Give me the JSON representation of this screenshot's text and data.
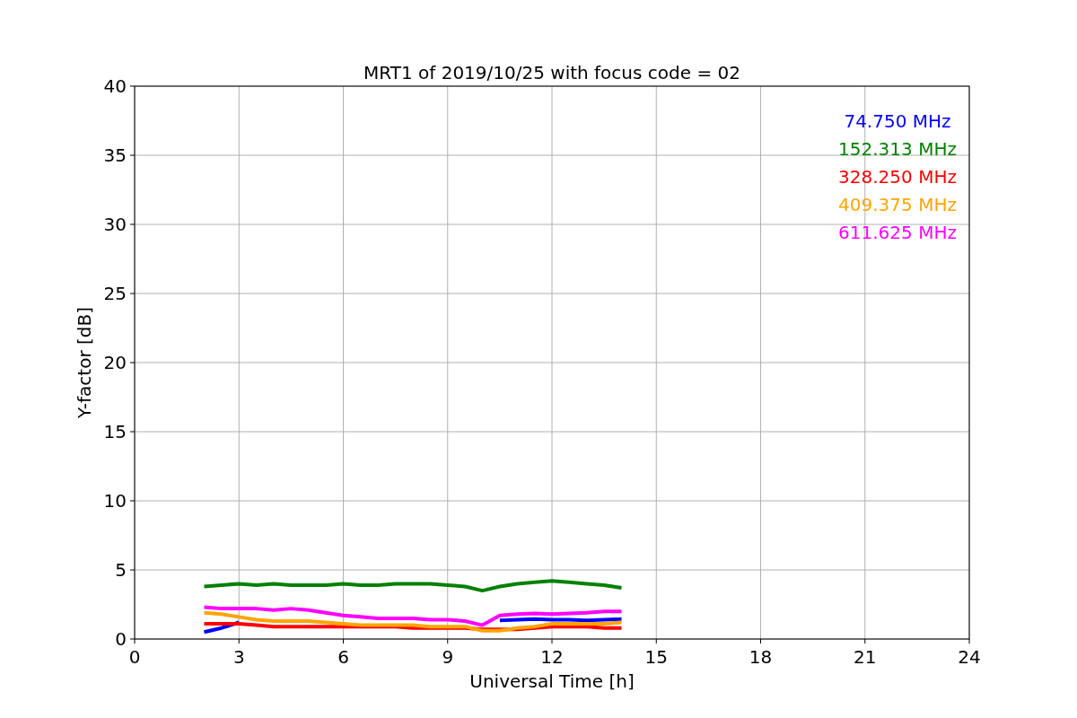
{
  "chart_data": {
    "type": "line",
    "title": "MRT1 of 2019/10/25 with focus code = 02",
    "xlabel": "Universal Time [h]",
    "ylabel": "Y-factor [dB]",
    "x": [
      2,
      2.5,
      3,
      3.5,
      4,
      4.5,
      5,
      5.5,
      6,
      6.5,
      7,
      7.5,
      8,
      8.5,
      9,
      9.5,
      10,
      10.5,
      11,
      11.5,
      12,
      12.5,
      13,
      13.5,
      14
    ],
    "series": [
      {
        "name": "74.750 MHz",
        "color": "#0000ff",
        "values": [
          0.5,
          0.8,
          1.2,
          null,
          null,
          null,
          null,
          null,
          null,
          null,
          null,
          null,
          null,
          null,
          null,
          null,
          null,
          1.35,
          1.4,
          1.45,
          1.4,
          1.4,
          1.35,
          1.4,
          1.45
        ]
      },
      {
        "name": "152.313 MHz",
        "color": "#008000",
        "values": [
          3.8,
          3.9,
          4.0,
          3.9,
          4.0,
          3.9,
          3.9,
          3.9,
          4.0,
          3.9,
          3.9,
          4.0,
          4.0,
          4.0,
          3.9,
          3.8,
          3.5,
          3.8,
          4.0,
          4.1,
          4.2,
          4.1,
          4.0,
          3.9,
          3.7
        ]
      },
      {
        "name": "328.250 MHz",
        "color": "#ff0000",
        "values": [
          1.1,
          1.1,
          1.1,
          1.0,
          0.9,
          0.9,
          0.9,
          0.9,
          0.9,
          0.9,
          0.9,
          0.9,
          0.8,
          0.8,
          0.8,
          0.8,
          0.7,
          0.7,
          0.7,
          0.8,
          0.9,
          0.9,
          0.9,
          0.8,
          0.8
        ]
      },
      {
        "name": "409.375 MHz",
        "color": "#ffa500",
        "values": [
          1.9,
          1.8,
          1.6,
          1.4,
          1.3,
          1.3,
          1.3,
          1.2,
          1.1,
          1.0,
          1.0,
          1.0,
          1.0,
          0.9,
          0.9,
          0.9,
          0.6,
          0.6,
          0.8,
          0.9,
          1.1,
          1.1,
          1.1,
          1.1,
          1.2
        ]
      },
      {
        "name": "611.625 MHz",
        "color": "#ff00ff",
        "values": [
          2.3,
          2.2,
          2.2,
          2.2,
          2.1,
          2.2,
          2.1,
          1.9,
          1.7,
          1.6,
          1.5,
          1.5,
          1.5,
          1.4,
          1.4,
          1.3,
          1.0,
          1.7,
          1.8,
          1.85,
          1.8,
          1.85,
          1.9,
          2.0,
          2.0
        ]
      }
    ],
    "grid": true,
    "xlim": [
      0,
      24
    ],
    "ylim": [
      0,
      40
    ],
    "xticks": [
      0,
      3,
      6,
      9,
      12,
      15,
      18,
      21,
      24
    ],
    "yticks": [
      0,
      5,
      10,
      15,
      20,
      25,
      30,
      35,
      40
    ]
  }
}
